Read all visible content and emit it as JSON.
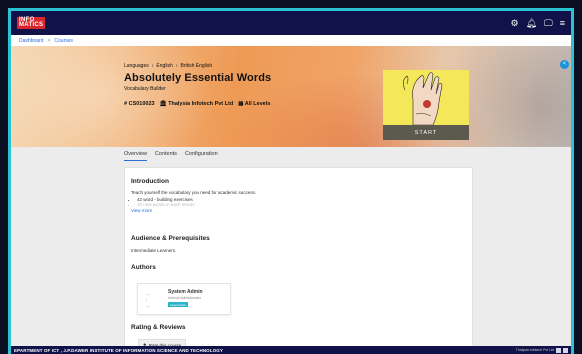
{
  "header": {
    "logo_text": "INFO\nMATICS",
    "icons": [
      "gear-icon",
      "bell-icon",
      "monitor-icon",
      "menu-icon"
    ]
  },
  "breadcrumb": {
    "items": [
      "Dashboard",
      "Courses"
    ]
  },
  "course": {
    "crumbs": [
      "Languages",
      "English",
      "British English"
    ],
    "title": "Absolutely Essential Words",
    "subtitle": "Vocabulary Builder",
    "code": "CS010023",
    "provider": "Thalysia Infotech Pvt Ltd",
    "level": "All Levels",
    "start_label": "START"
  },
  "tabs": [
    "Overview",
    "Contents",
    "Configuration"
  ],
  "overview": {
    "intro_heading": "Introduction",
    "intro_text": "Teach yourself the vocabulary you need for academic success.",
    "bullets": [
      "42 word - building exercises",
      "10 new words in each lesson"
    ],
    "view_more": "View more",
    "audience_heading": "Audience & Prerequisites",
    "audience_text": "Intermediate Learners.",
    "authors_heading": "Authors",
    "author_name": "System Admin",
    "author_role": "Instruct Administrator",
    "author_badge": "Lead Author",
    "rating_heading": "Rating & Reviews",
    "rate_label": "Rate this course"
  },
  "footer": {
    "left_text": "EPARTMENT OF ICT , J.P.DAWER INSTITUTE OF INFORMATION SCIENCE AND TECHNOLOGY",
    "right_text": "Thalysia Infotech Pvt Ltd"
  },
  "colors": {
    "brand": "#12124a",
    "accent": "#2a6fd6",
    "frame": "#2ac3d3",
    "badge": "#2bb5c8"
  }
}
